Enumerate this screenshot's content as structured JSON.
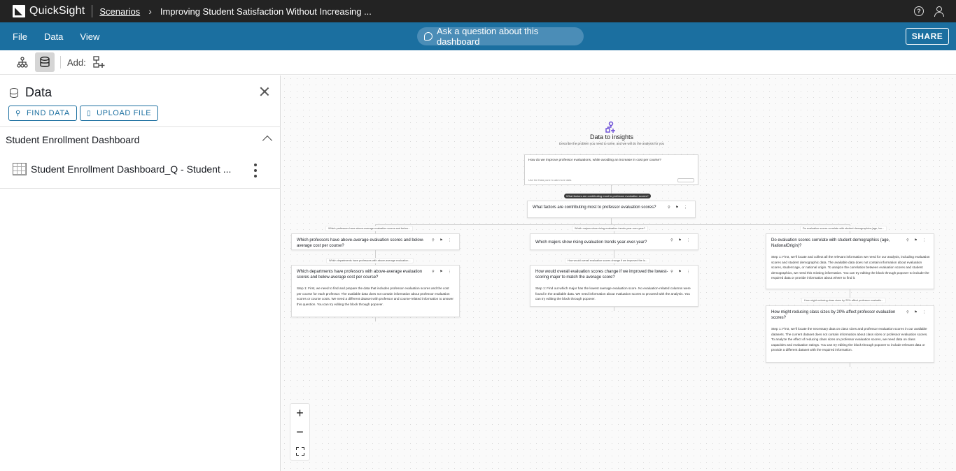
{
  "app": {
    "name": "QuickSight"
  },
  "breadcrumb": {
    "root": "Scenarios",
    "title": "Improving Student Satisfaction Without Increasing ..."
  },
  "menu": {
    "file": "File",
    "data": "Data",
    "view": "View",
    "ask": "Ask a question about this dashboard",
    "share": "SHARE"
  },
  "toolbar": {
    "add_label": "Add:"
  },
  "panel": {
    "title": "Data",
    "find_data": "FIND DATA",
    "upload_file": "UPLOAD FILE",
    "dataset_group": "Student Enrollment Dashboard",
    "dataset_name": "Student Enrollment Dashboard_Q - Student ..."
  },
  "canvas": {
    "hub_title": "Data to insights",
    "hub_subtitle": "Describe the problem you need to solve, and we will do the analysis for you",
    "prompt_text": "How do we improve professor evaluations, while avoiding an increase in cost per course?",
    "prompt_hint": "Use the Data pane to add more data",
    "root_pill": "What factors are contributing most to professor evaluation scores?",
    "root_card": "What factors are contributing most to professor evaluation scores?",
    "edge1": "Which professors have above-average evaluation scores and below...",
    "edge2": "Which majors show rising evaluation trends year-over-year?",
    "edge3": "Do evaluation scores correlate with student demographics (age, loc...",
    "card1": "Which professors have above-average evaluation scores and below-average cost per course?",
    "card2": "Which majors show rising evaluation trends year-over-year?",
    "card3": "Do evaluation scores correlate with student demographics (age, NationalOrigin)?",
    "card3_body": "Step 1: First, we'll locate and collect all the relevant information we need for our analysis, including evaluation scores and student demographic data. The available data does not contain information about evaluation scores, student age, or national origin. To analyze the correlation between evaluation scores and student demographics, we need this missing information. You can try editing the block through popover to include the required data or provide information about where to find it.",
    "edge4": "Which departments have professors with above-average evaluation...",
    "card4": "Which departments have professors with above-average evaluation scores and below-average cost per course?",
    "card4_body": "Step 1: First, we need to find and prepare the data that includes professor evaluation scores and the cost per course for each professor. The available data does not contain information about professor evaluation scores or course costs. We need a different dataset with professor and course-related information to answer this question. You can try editing the block through popover.",
    "edge5": "How would overall evaluation scores change if we improved the lo...",
    "card5": "How would overall evaluation scores change if we improved the lowest-scoring major to match the average score?",
    "card5_body": "Step 1: Find out which major has the lowest average evaluation score. No evaluation-related columns were found in the available data. We need information about evaluation scores to proceed with the analysis. You can try editing the block through popover.",
    "edge6": "How might reducing class sizes by 20% affect professor evaluatio...",
    "card6": "How might reducing class sizes by 20% affect professor evaluation scores?",
    "card6_body": "Step 1: First, we'll locate the necessary data on class sizes and professor evaluation scores in our available datasets. The current dataset does not contain information about class sizes or professor evaluation scores. To analyze the effect of reducing class sizes on professor evaluation scores, we need data on class capacities and evaluation ratings. You can try editing the block through popover to include relevant data or provide a different dataset with the required information."
  },
  "zoom": {
    "in": "+",
    "out": "−"
  },
  "colors": {
    "topbar": "#232323",
    "menubar": "#1b6fa0",
    "accent": "#1b6fa0"
  }
}
